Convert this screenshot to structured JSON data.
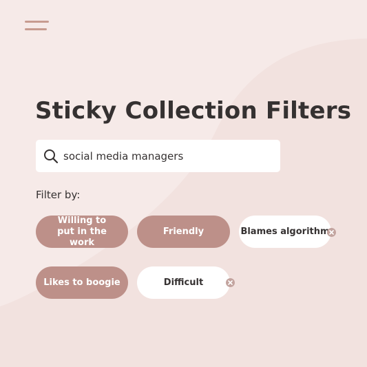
{
  "header": {
    "menu_icon": "hamburger-menu-icon"
  },
  "page": {
    "title": "Sticky Collection Filters"
  },
  "search": {
    "value": "social media managers",
    "icon": "search-icon"
  },
  "filters": {
    "label": "Filter by:",
    "chips": [
      {
        "label": "Willing to put in the work",
        "selected": false
      },
      {
        "label": "Friendly",
        "selected": false
      },
      {
        "label": "Blames algorithm",
        "selected": true
      },
      {
        "label": "Likes to boogie",
        "selected": false
      },
      {
        "label": "Difficult",
        "selected": true
      }
    ],
    "remove_icon": "close-circle-icon"
  },
  "colors": {
    "background": "#f6eae8",
    "accent": "#bd9089",
    "text": "#353131",
    "chip_selected_bg": "#ffffff",
    "remove_badge": "#c3a49f"
  }
}
